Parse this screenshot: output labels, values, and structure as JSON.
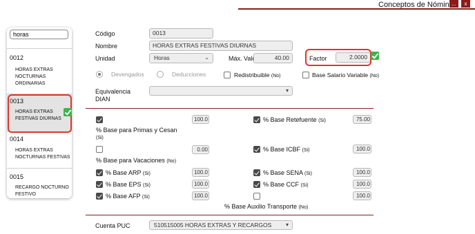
{
  "window": {
    "title": "Conceptos de Nómina",
    "minimize_label": "...",
    "close_label": "x"
  },
  "sidebar": {
    "search_value": "horas",
    "items": [
      {
        "code": "0012",
        "desc": "HORAS EXTRAS NOCTURNAS ORDINARIAS"
      },
      {
        "code": "0013",
        "desc": "HORAS EXTRAS FESTIVAS DIURNAS"
      },
      {
        "code": "0014",
        "desc": "HORAS EXTRAS NOCTURNAS FESTIVAS"
      },
      {
        "code": "0015",
        "desc": "RECARGO NOCTURNO FESTIVO"
      }
    ]
  },
  "form": {
    "codigo_label": "Código",
    "codigo_value": "0013",
    "nombre_label": "Nombre",
    "nombre_value": "HORAS EXTRAS FESTIVAS DIURNAS",
    "unidad_label": "Unidad",
    "unidad_value": "Horas",
    "max_valor_label": "Máx. Valor",
    "max_valor_value": "40.00",
    "factor_label": "Factor",
    "factor_value": "2.0000",
    "devengados_label": "Devengados",
    "deducciones_label": "Deducciones",
    "redistribuible_label": "Redistribuible",
    "redistribuible_suffix": "(No)",
    "base_salario_label": "Base Salario Variable",
    "base_salario_suffix": "(No)",
    "equivalencia_label_1": "Equivalencia",
    "equivalencia_label_2": "DIAN",
    "cuenta_puc_label": "Cuenta PUC",
    "cuenta_puc_value": "510515005 HORAS EXTRAS Y RECARGOS"
  },
  "bases": {
    "primas_value": "100.0",
    "primas_label": "% Base para Primas y Cesan",
    "primas_suffix": "(Si)",
    "retefuente_label": "% Base Retefuente",
    "retefuente_suffix": "(Si)",
    "retefuente_value": "75.00",
    "vacaciones_value": "0.00",
    "vacaciones_label": "% Base para Vacaciones",
    "vacaciones_suffix": "(No)",
    "icbf_label": "% Base ICBF",
    "icbf_suffix": "(Si)",
    "icbf_value": "100.0",
    "arp_label": "% Base ARP",
    "arp_suffix": "(Si)",
    "arp_value": "100.0",
    "sena_label": "% Base SENA",
    "sena_suffix": "(Si)",
    "sena_value": "100.0",
    "eps_label": "% Base EPS",
    "eps_suffix": "(Si)",
    "eps_value": "100.0",
    "ccf_label": "% Base CCF",
    "ccf_suffix": "(Si)",
    "ccf_value": "100.0",
    "afp_label": "% Base AFP",
    "afp_suffix": "(Si)",
    "afp_value": "100.0",
    "aux_transporte_label": "% Base Auxilio Transporte",
    "aux_transporte_suffix": "(No)",
    "aux_transporte_value": "100.0"
  },
  "colors": {
    "accent": "#8b1b1b",
    "highlight": "#e0342a",
    "ok": "#3cb44b"
  }
}
